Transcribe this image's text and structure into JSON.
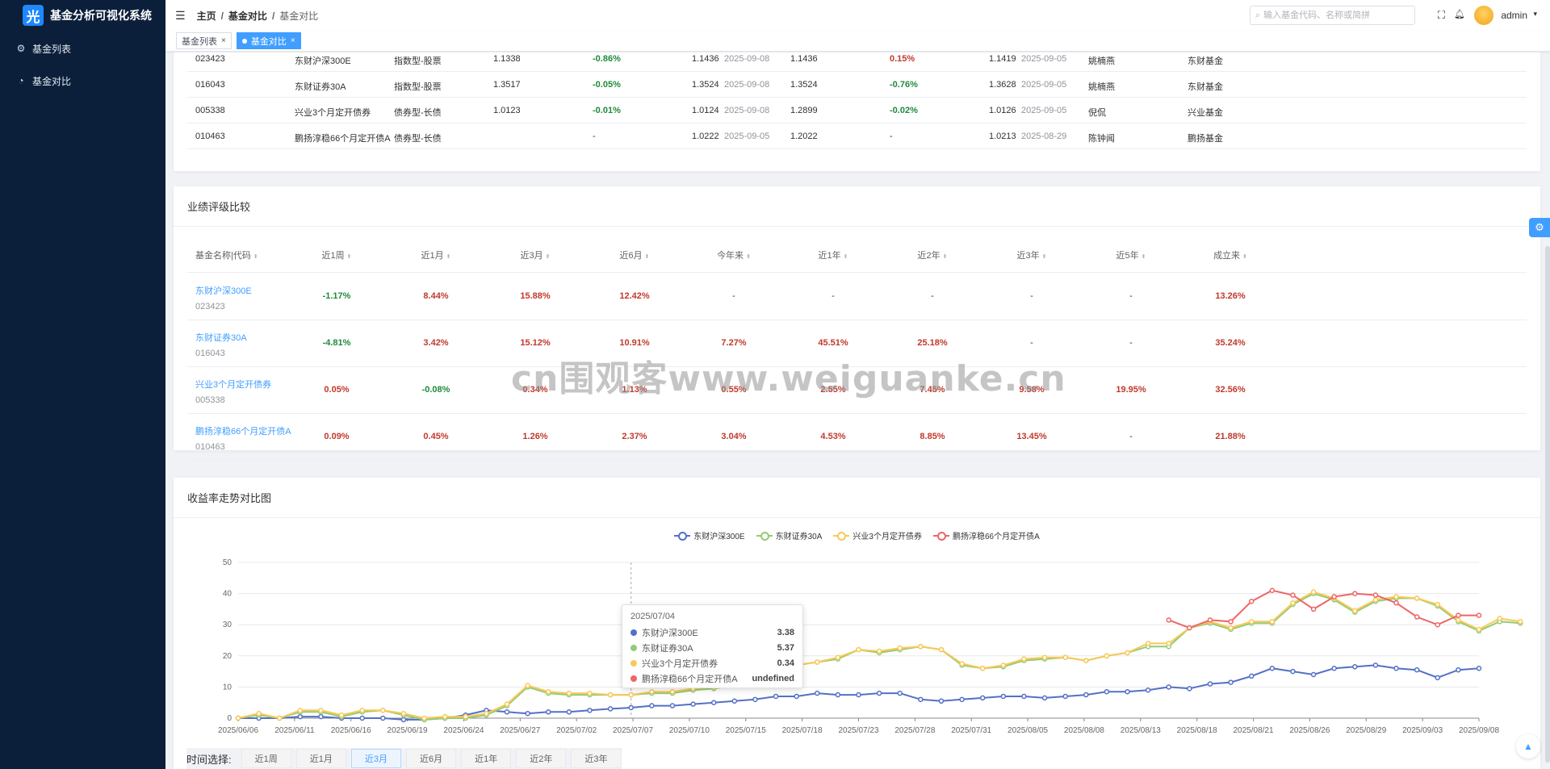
{
  "app": {
    "title": "基金分析可视化系统",
    "logo_char": "光"
  },
  "sidebar": {
    "items": [
      {
        "label": "基金列表",
        "icon": "gear-icon"
      },
      {
        "label": "基金对比",
        "icon": "compare-icon"
      }
    ]
  },
  "header": {
    "breadcrumb": [
      "主页",
      "基金对比",
      "基金对比"
    ],
    "search_placeholder": "输入基金代码、名称或简拼",
    "username": "admin"
  },
  "tags": [
    {
      "label": "基金列表",
      "active": false
    },
    {
      "label": "基金对比",
      "active": true
    }
  ],
  "basic_table": {
    "rows": [
      [
        "023423",
        "东财沪深300E",
        "指数型-股票",
        "1.1338",
        "-0.86%",
        "1.1436",
        "2025-09-08",
        "1.1436",
        "0.15%",
        "1.1419",
        "2025-09-05",
        "姚楠燕",
        "东财基金"
      ],
      [
        "016043",
        "东财证券30A",
        "指数型-股票",
        "1.3517",
        "-0.05%",
        "1.3524",
        "2025-09-08",
        "1.3524",
        "-0.76%",
        "1.3628",
        "2025-09-05",
        "姚楠燕",
        "东财基金"
      ],
      [
        "005338",
        "兴业3个月定开债券",
        "债券型-长债",
        "1.0123",
        "-0.01%",
        "1.0124",
        "2025-09-08",
        "1.2899",
        "-0.02%",
        "1.0126",
        "2025-09-05",
        "倪侃",
        "兴业基金"
      ],
      [
        "010463",
        "鹏扬淳稳66个月定开债A",
        "债券型-长债",
        "",
        "-",
        "1.0222",
        "2025-09-05",
        "1.2022",
        "-",
        "1.0213",
        "2025-08-29",
        "陈钟闻",
        "鹏扬基金"
      ]
    ]
  },
  "perf": {
    "title": "业绩评级比较",
    "headers": [
      "基金名称|代码",
      "近1周",
      "近1月",
      "近3月",
      "近6月",
      "今年来",
      "近1年",
      "近2年",
      "近3年",
      "近5年",
      "成立来"
    ],
    "rows": [
      {
        "name": "东财沪深300E",
        "code": "023423",
        "values": [
          "-1.17%",
          "8.44%",
          "15.88%",
          "12.42%",
          "-",
          "-",
          "-",
          "-",
          "-",
          "13.26%"
        ]
      },
      {
        "name": "东财证券30A",
        "code": "016043",
        "values": [
          "-4.81%",
          "3.42%",
          "15.12%",
          "10.91%",
          "7.27%",
          "45.51%",
          "25.18%",
          "-",
          "-",
          "35.24%"
        ]
      },
      {
        "name": "兴业3个月定开债券",
        "code": "005338",
        "values": [
          "0.05%",
          "-0.08%",
          "0.34%",
          "1.13%",
          "0.55%",
          "2.55%",
          "7.45%",
          "9.58%",
          "19.95%",
          "32.56%"
        ]
      },
      {
        "name": "鹏扬淳稳66个月定开债A",
        "code": "010463",
        "values": [
          "0.09%",
          "0.45%",
          "1.26%",
          "2.37%",
          "3.04%",
          "4.53%",
          "8.85%",
          "13.45%",
          "-",
          "21.88%"
        ]
      }
    ]
  },
  "trend": {
    "title": "收益率走势对比图"
  },
  "tooltip": {
    "date": "2025/07/04",
    "rows": [
      {
        "name": "东财沪深300E",
        "value": "3.38"
      },
      {
        "name": "东财证券30A",
        "value": "5.37"
      },
      {
        "name": "兴业3个月定开债券",
        "value": "0.34"
      },
      {
        "name": "鹏扬淳稳66个月定开债A",
        "value": "undefined"
      }
    ]
  },
  "time_selector": {
    "label": "时间选择:",
    "options": [
      "近1周",
      "近1月",
      "近3月",
      "近6月",
      "近1年",
      "近2年",
      "近3年"
    ],
    "active": "近3月"
  },
  "watermark": "cn围观客www.weiguanke.cn",
  "chart_data": {
    "type": "line",
    "xlabels": [
      "2025/06/06",
      "2025/06/11",
      "2025/06/16",
      "2025/06/19",
      "2025/06/24",
      "2025/06/27",
      "2025/07/02",
      "2025/07/07",
      "2025/07/10",
      "2025/07/15",
      "2025/07/18",
      "2025/07/23",
      "2025/07/28",
      "2025/07/31",
      "2025/08/05",
      "2025/08/08",
      "2025/08/13",
      "2025/08/18",
      "2025/08/21",
      "2025/08/26",
      "2025/08/29",
      "2025/09/03",
      "2025/09/08"
    ],
    "ylim": [
      0,
      50
    ],
    "yticks": [
      0,
      10,
      20,
      30,
      40,
      50
    ],
    "colors": [
      "#5470c6",
      "#91cc75",
      "#fac858",
      "#ee6666"
    ],
    "series": [
      {
        "name": "东财沪深300E",
        "values": [
          0,
          0,
          0,
          0.5,
          0.5,
          0,
          0,
          0,
          -0.5,
          -0.5,
          0,
          1,
          2.5,
          2,
          1.5,
          2,
          2,
          2.5,
          3,
          3.38,
          4,
          4,
          4.5,
          5,
          5.5,
          6,
          7,
          7,
          8,
          7.5,
          7.5,
          8,
          8,
          6,
          5.5,
          6,
          6.5,
          7,
          7,
          6.5,
          7,
          7.5,
          8.5,
          8.5,
          9,
          10,
          9.5,
          11,
          11.5,
          13.5,
          16,
          15,
          14,
          16,
          16.5,
          17,
          16,
          15.5,
          13,
          15.5,
          16
        ]
      },
      {
        "name": "东财证券30A",
        "values": [
          0,
          1,
          0,
          2,
          2,
          0.5,
          2,
          2.5,
          1,
          -0.5,
          0,
          0,
          1,
          4,
          10,
          8,
          7.5,
          7.5,
          7.5,
          7.5,
          8,
          8,
          9,
          9.5,
          10.5,
          13,
          15,
          17,
          18,
          19,
          22,
          21,
          22,
          23,
          22,
          17,
          16,
          16.5,
          18.5,
          19,
          19.5,
          18.5,
          20,
          21,
          23,
          23,
          29,
          30.5,
          28.5,
          30.5,
          30.5,
          36.5,
          40,
          38,
          34,
          37.5,
          38.5,
          38.5,
          36,
          31,
          28,
          31,
          30.5
        ]
      },
      {
        "name": "兴业3个月定开债券",
        "values": [
          0,
          1.5,
          0,
          2.5,
          2.5,
          1,
          2.5,
          2.5,
          1.5,
          0,
          0.5,
          0.5,
          1.5,
          4.5,
          10.5,
          8.5,
          8,
          8,
          7.5,
          7.5,
          8.5,
          8.5,
          9.5,
          10,
          11,
          13.5,
          15.5,
          17,
          18,
          19.5,
          22,
          21.5,
          22.5,
          23,
          22,
          17.5,
          16,
          17,
          19,
          19.5,
          19.5,
          18.5,
          20,
          21,
          24,
          24,
          29,
          31,
          29,
          31,
          31,
          37,
          40.5,
          38.5,
          34.5,
          38,
          39,
          38.5,
          36.5,
          31.5,
          28.5,
          32,
          31
        ]
      },
      {
        "name": "鹏扬淳稳66个月定开债A",
        "values": [
          null,
          null,
          null,
          null,
          null,
          null,
          null,
          null,
          null,
          null,
          null,
          null,
          null,
          null,
          null,
          null,
          null,
          null,
          null,
          null,
          null,
          null,
          null,
          null,
          null,
          null,
          null,
          null,
          null,
          null,
          null,
          null,
          null,
          null,
          null,
          null,
          null,
          null,
          null,
          null,
          null,
          null,
          null,
          null,
          null,
          31.5,
          29,
          31.5,
          31,
          37.5,
          41,
          39.5,
          35,
          39,
          40,
          39.5,
          37,
          32.5,
          30,
          33,
          33
        ]
      }
    ]
  }
}
